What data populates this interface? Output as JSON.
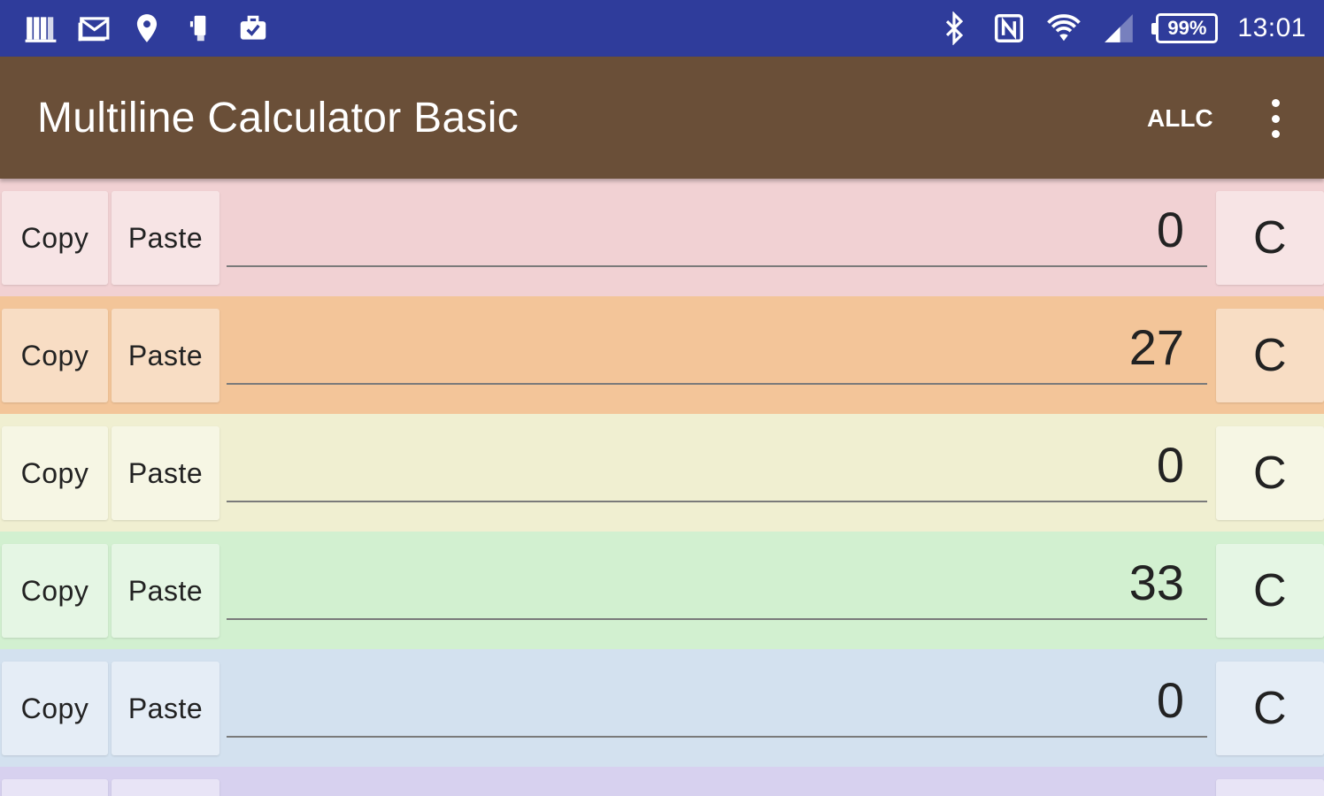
{
  "status_bar": {
    "left_icons": [
      "books-icon",
      "mail-icon",
      "location-pin-icon",
      "phone-vibrate-icon",
      "work-briefcase-icon"
    ],
    "right_icons": [
      "bluetooth-icon",
      "nfc-icon",
      "wifi-icon",
      "signal-icon"
    ],
    "battery": "99%",
    "time": "13:01",
    "color": "#2f3c9b"
  },
  "app_bar": {
    "title": "Multiline Calculator Basic",
    "allc_label": "ALLC",
    "color": "#6a4f38"
  },
  "rows": [
    {
      "copy_label": "Copy",
      "paste_label": "Paste",
      "value": "0",
      "clear_label": "C",
      "color": "#f1d1d3"
    },
    {
      "copy_label": "Copy",
      "paste_label": "Paste",
      "value": "27",
      "clear_label": "C",
      "color": "#f3c599"
    },
    {
      "copy_label": "Copy",
      "paste_label": "Paste",
      "value": "0",
      "clear_label": "C",
      "color": "#f0efd1"
    },
    {
      "copy_label": "Copy",
      "paste_label": "Paste",
      "value": "33",
      "clear_label": "C",
      "color": "#d2f0d0"
    },
    {
      "copy_label": "Copy",
      "paste_label": "Paste",
      "value": "0",
      "clear_label": "C",
      "color": "#d3e1ef"
    },
    {
      "color": "#d7d1ef"
    }
  ]
}
